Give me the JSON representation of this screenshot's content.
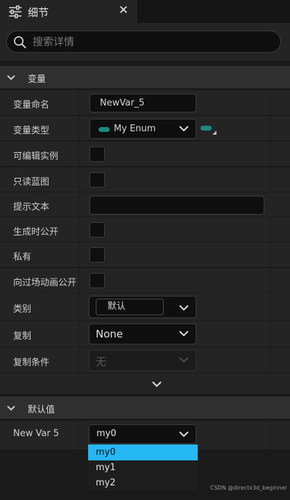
{
  "panel": {
    "tab_title": "细节",
    "close_glyph": "✕",
    "tab_icon": "sliders-icon"
  },
  "search": {
    "placeholder": "搜索详情",
    "value": ""
  },
  "sections": {
    "variables": {
      "title": "变量",
      "rows": {
        "name": {
          "label": "变量命名",
          "value": "NewVar_5"
        },
        "type": {
          "label": "变量类型",
          "value": "My Enum",
          "pill_color": "#1c8a7c"
        },
        "editable": {
          "label": "可编辑实例",
          "checked": false
        },
        "readonly": {
          "label": "只读蓝图",
          "checked": false
        },
        "tooltip": {
          "label": "提示文本",
          "value": ""
        },
        "expose_spawn": {
          "label": "生成时公开",
          "checked": false
        },
        "private": {
          "label": "私有",
          "checked": false
        },
        "expose_cinematics": {
          "label": "向过场动画公开",
          "checked": false
        },
        "category": {
          "label": "类别",
          "value": "默认"
        },
        "replication": {
          "label": "复制",
          "value": "None"
        },
        "rep_condition": {
          "label": "复制条件",
          "value": "无"
        }
      }
    },
    "default_value": {
      "title": "默认值",
      "row": {
        "label": "New Var 5",
        "value": "my0"
      }
    }
  },
  "dropdown": {
    "options": [
      "my0",
      "my1",
      "my2"
    ],
    "selected_index": 0,
    "highlight_color": "#26b7f5"
  },
  "watermark": "CSDN @directx3d_beginner"
}
